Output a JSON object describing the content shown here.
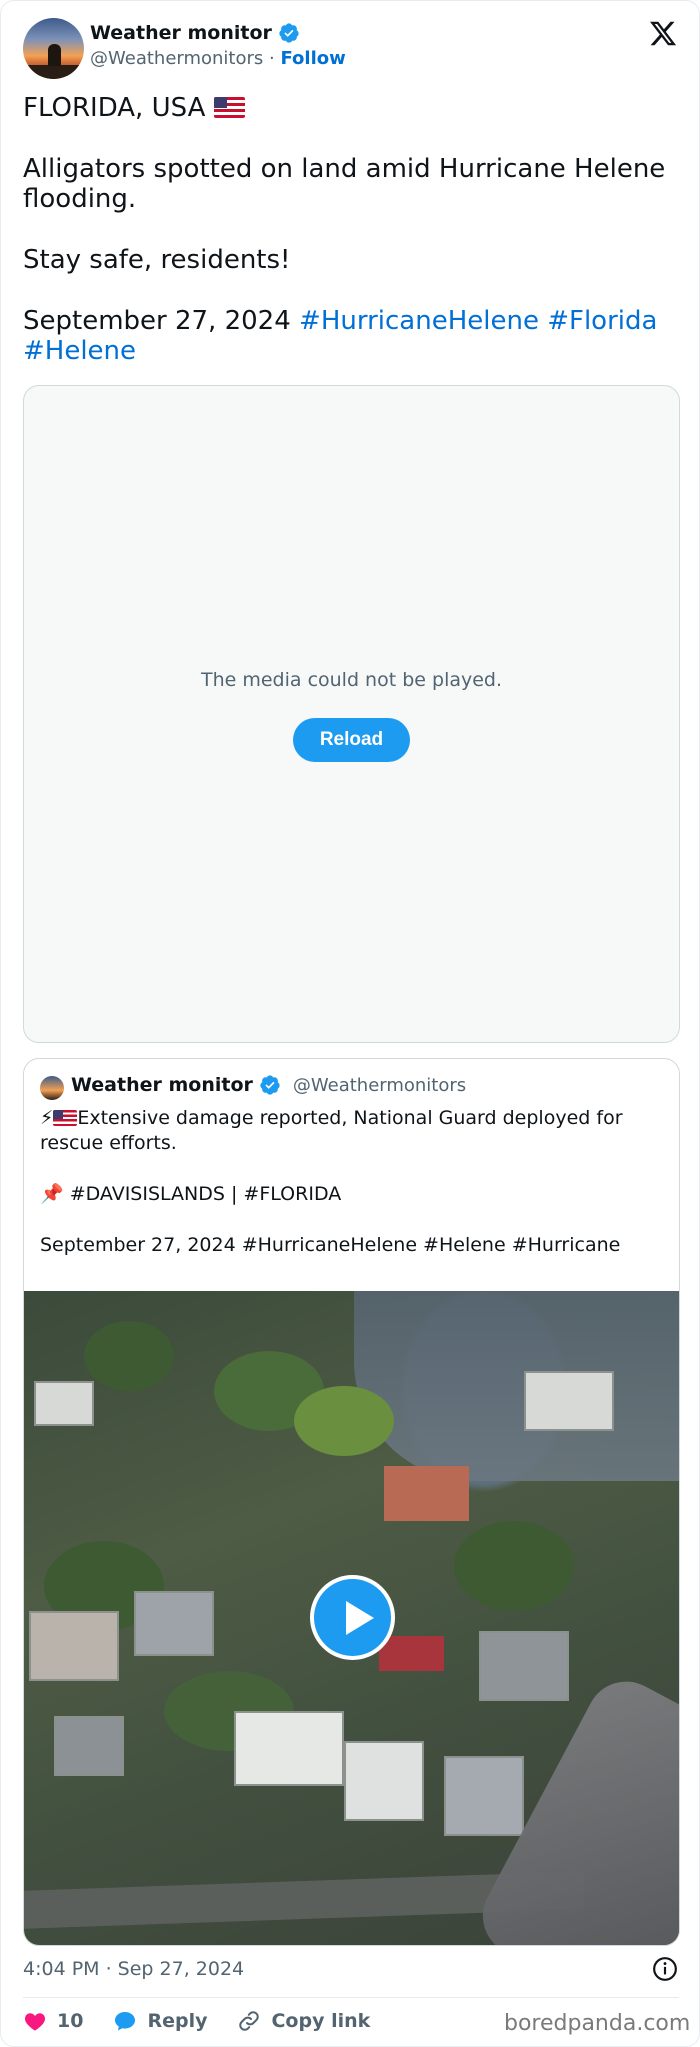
{
  "author": {
    "name": "Weather monitor",
    "handle": "@Weathermonitors",
    "separator": "·",
    "follow_label": "Follow"
  },
  "tweet": {
    "line1": "FLORIDA, USA",
    "line2": "Alligators spotted on land amid Hurricane Helene flooding.",
    "line3": "Stay safe, residents!",
    "line4_date": "September 27, 2024",
    "hashtags": [
      "#HurricaneHelene",
      "#Florida",
      "#Helene"
    ]
  },
  "media": {
    "error_message": "The media could not be played.",
    "reload_label": "Reload"
  },
  "quoted_tweet": {
    "name": "Weather monitor",
    "handle": "@Weathermonitors",
    "line1_prefix": "⚡",
    "line1": "Extensive damage reported, National Guard deployed for rescue efforts.",
    "line2": "📌 #DAVISISLANDS | #FLORIDA",
    "line3": "September 27, 2024 #HurricaneHelene #Helene #Hurricane"
  },
  "footer": {
    "timestamp": "4:04 PM · Sep 27, 2024",
    "like_count": "10",
    "reply_label": "Reply",
    "copy_link_label": "Copy link"
  },
  "watermark": "boredpanda.com",
  "colors": {
    "link": "#006fd6",
    "accent": "#1d9bf0",
    "like": "#f91880",
    "muted": "#536471"
  },
  "icons": [
    "verified-badge-icon",
    "x-logo-icon",
    "play-icon",
    "info-icon",
    "heart-icon",
    "reply-bubble-icon",
    "link-icon",
    "us-flag-icon",
    "pushpin-icon",
    "lightning-icon"
  ]
}
